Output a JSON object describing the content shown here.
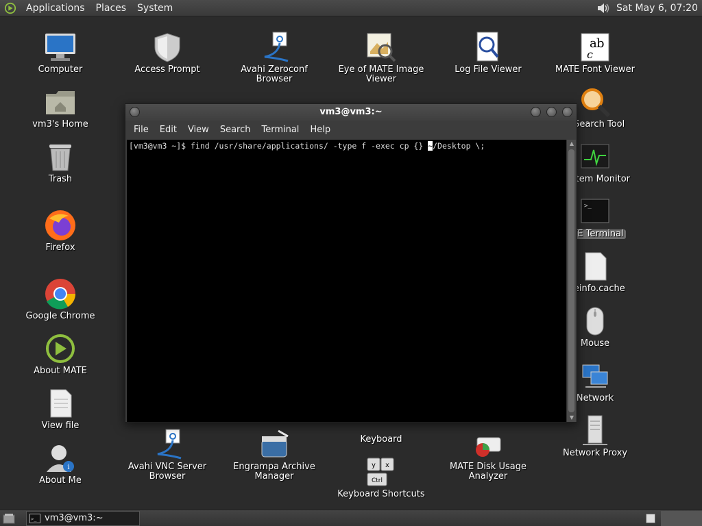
{
  "top_panel": {
    "menus": [
      "Applications",
      "Places",
      "System"
    ],
    "clock": "Sat May  6, 07:20"
  },
  "desktop_icons": [
    {
      "label": "Computer"
    },
    {
      "label": "vm3's Home"
    },
    {
      "label": "Trash"
    },
    {
      "label": "Firefox"
    },
    {
      "label": "Google Chrome"
    },
    {
      "label": "About MATE"
    },
    {
      "label": "View file"
    },
    {
      "label": "About Me"
    },
    {
      "label": "Access Prompt"
    },
    {
      "label": "Avahi Zeroconf\nBrowser"
    },
    {
      "label": "Eye of MATE Image\nViewer"
    },
    {
      "label": "Log File Viewer"
    },
    {
      "label": "MATE Font Viewer"
    },
    {
      "label": "E Search Tool"
    },
    {
      "label": "System Monitor"
    },
    {
      "label": "ATE Terminal"
    },
    {
      "label": "meinfo.cache"
    },
    {
      "label": "Mouse"
    },
    {
      "label": "Network"
    },
    {
      "label": "Network Proxy"
    },
    {
      "label": "Avahi VNC Server\nBrowser"
    },
    {
      "label": "Engrampa Archive\nManager"
    },
    {
      "label": "Keyboard"
    },
    {
      "label": "MATE Disk Usage\nAnalyzer"
    },
    {
      "label": "Keyboard Shortcuts"
    }
  ],
  "terminal": {
    "title": "vm3@vm3:~",
    "menus": [
      "File",
      "Edit",
      "View",
      "Search",
      "Terminal",
      "Help"
    ],
    "prompt": "[vm3@vm3 ~]$ find /usr/share/applications/ -type f -exec cp {} ",
    "cursor_char": "~",
    "rest": "/Desktop \\;"
  },
  "bottom_panel": {
    "task_label": "vm3@vm3:~"
  },
  "colors": {
    "desktop_bg": "#2b2b2b",
    "terminal_bg": "#000000",
    "panel_bg": "#3a3a3a"
  }
}
